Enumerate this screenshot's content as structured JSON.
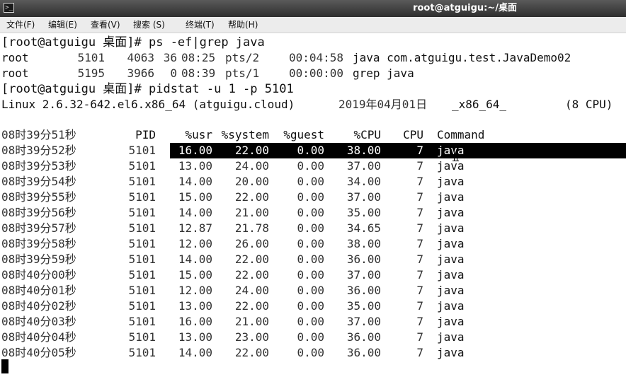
{
  "window": {
    "title": "root@atguigu:~/桌面",
    "icon": "terminal-icon"
  },
  "menubar": {
    "items": [
      "文件(F)",
      "编辑(E)",
      "查看(V)",
      "搜索 (S)",
      "终端(T)",
      "帮助(H)"
    ]
  },
  "terminal": {
    "prompt1": "[root@atguigu 桌面]# ps -ef|grep java",
    "ps_rows": [
      {
        "user": "root",
        "pid": "5101",
        "ppid": "4063",
        "c": "36",
        "stime": "08:25",
        "tty": "pts/2",
        "time": "00:04:58",
        "cmd": "java com.atguigu.test.JavaDemo02"
      },
      {
        "user": "root",
        "pid": "5195",
        "ppid": "3966",
        "c": "0",
        "stime": "08:39",
        "tty": "pts/1",
        "time": "00:00:00",
        "cmd": "grep java"
      }
    ],
    "prompt2": "[root@atguigu 桌面]# pidstat -u 1 -p 5101",
    "sysinfo": {
      "kernel": "Linux 2.6.32-642.el6.x86_64 (atguigu.cloud)",
      "date": "2019年04月01日",
      "arch": "_x86_64_",
      "cpus": "(8 CPU)"
    },
    "pidstat_header": {
      "time": "08时39分51秒",
      "pid": "PID",
      "usr": "%usr",
      "system": "%system",
      "guest": "%guest",
      "cpu": "%CPU",
      "cpu_num": "CPU",
      "command": "Command"
    },
    "pidstat_rows": [
      {
        "time": "08时39分52秒",
        "pid": "5101",
        "usr": "16.00",
        "system": "22.00",
        "guest": "0.00",
        "cpu": "38.00",
        "cpu_num": "7",
        "command": "java"
      },
      {
        "time": "08时39分53秒",
        "pid": "5101",
        "usr": "13.00",
        "system": "24.00",
        "guest": "0.00",
        "cpu": "37.00",
        "cpu_num": "7",
        "command": "java"
      },
      {
        "time": "08时39分54秒",
        "pid": "5101",
        "usr": "14.00",
        "system": "20.00",
        "guest": "0.00",
        "cpu": "34.00",
        "cpu_num": "7",
        "command": "java"
      },
      {
        "time": "08时39分55秒",
        "pid": "5101",
        "usr": "15.00",
        "system": "22.00",
        "guest": "0.00",
        "cpu": "37.00",
        "cpu_num": "7",
        "command": "java"
      },
      {
        "time": "08时39分56秒",
        "pid": "5101",
        "usr": "14.00",
        "system": "21.00",
        "guest": "0.00",
        "cpu": "35.00",
        "cpu_num": "7",
        "command": "java"
      },
      {
        "time": "08时39分57秒",
        "pid": "5101",
        "usr": "12.87",
        "system": "21.78",
        "guest": "0.00",
        "cpu": "34.65",
        "cpu_num": "7",
        "command": "java"
      },
      {
        "time": "08时39分58秒",
        "pid": "5101",
        "usr": "12.00",
        "system": "26.00",
        "guest": "0.00",
        "cpu": "38.00",
        "cpu_num": "7",
        "command": "java"
      },
      {
        "time": "08时39分59秒",
        "pid": "5101",
        "usr": "14.00",
        "system": "22.00",
        "guest": "0.00",
        "cpu": "36.00",
        "cpu_num": "7",
        "command": "java"
      },
      {
        "time": "08时40分00秒",
        "pid": "5101",
        "usr": "15.00",
        "system": "22.00",
        "guest": "0.00",
        "cpu": "37.00",
        "cpu_num": "7",
        "command": "java"
      },
      {
        "time": "08时40分01秒",
        "pid": "5101",
        "usr": "12.00",
        "system": "24.00",
        "guest": "0.00",
        "cpu": "36.00",
        "cpu_num": "7",
        "command": "java"
      },
      {
        "time": "08时40分02秒",
        "pid": "5101",
        "usr": "13.00",
        "system": "22.00",
        "guest": "0.00",
        "cpu": "35.00",
        "cpu_num": "7",
        "command": "java"
      },
      {
        "time": "08时40分03秒",
        "pid": "5101",
        "usr": "16.00",
        "system": "21.00",
        "guest": "0.00",
        "cpu": "37.00",
        "cpu_num": "7",
        "command": "java"
      },
      {
        "time": "08时40分04秒",
        "pid": "5101",
        "usr": "13.00",
        "system": "23.00",
        "guest": "0.00",
        "cpu": "36.00",
        "cpu_num": "7",
        "command": "java"
      },
      {
        "time": "08时40分05秒",
        "pid": "5101",
        "usr": "14.00",
        "system": "22.00",
        "guest": "0.00",
        "cpu": "36.00",
        "cpu_num": "7",
        "command": "java"
      }
    ],
    "selected_row": 0
  }
}
